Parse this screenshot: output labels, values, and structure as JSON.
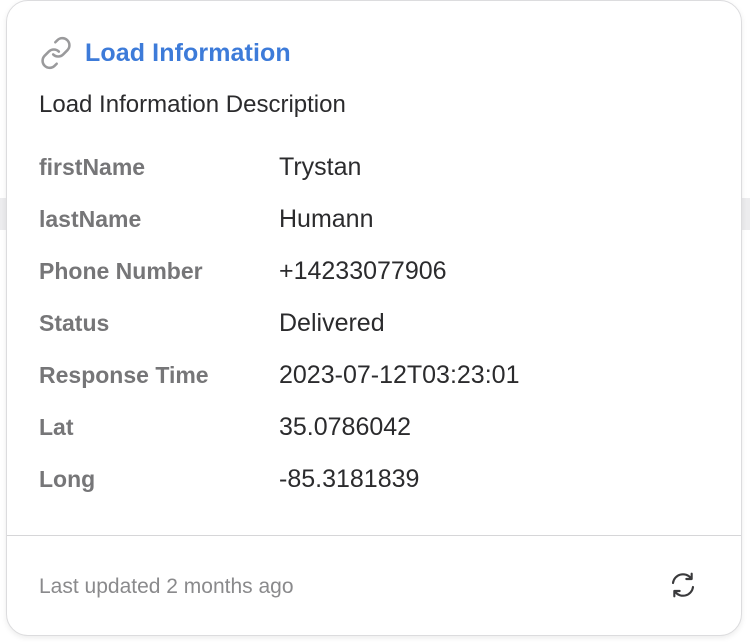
{
  "card": {
    "title": "Load Information",
    "description": "Load Information Description",
    "icon": "link-icon",
    "accent_color": "#3d7bd9",
    "fields": [
      {
        "label": "firstName",
        "value": "Trystan"
      },
      {
        "label": "lastName",
        "value": "Humann"
      },
      {
        "label": "Phone Number",
        "value": "+14233077906"
      },
      {
        "label": "Status",
        "value": "Delivered"
      },
      {
        "label": "Response Time",
        "value": "2023-07-12T03:23:01"
      },
      {
        "label": "Lat",
        "value": "35.0786042"
      },
      {
        "label": "Long",
        "value": "-85.3181839"
      }
    ]
  },
  "footer": {
    "last_updated": "Last updated 2 months ago",
    "refresh_icon": "refresh-icon"
  }
}
